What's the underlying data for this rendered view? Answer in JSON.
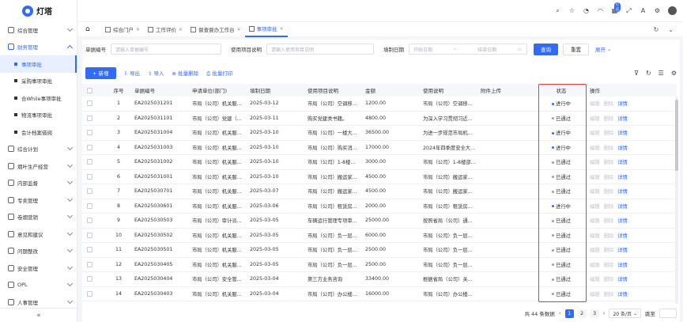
{
  "app": {
    "name": "灯塔"
  },
  "colors": {
    "primary": "#2f6bff",
    "status_running": "#2f6bff",
    "status_passed": "#9aa0a6",
    "highlight_border": "#e0403a"
  },
  "sidebar": {
    "items_top": [
      {
        "label": "综合管理",
        "icon": "grid-icon"
      },
      {
        "label": "财务管理",
        "icon": "finance-icon"
      }
    ],
    "sub_items": [
      {
        "label": "事项审批"
      },
      {
        "label": "采购事项审批"
      },
      {
        "label": "合While事项审批"
      },
      {
        "label": "物流事项审批"
      },
      {
        "label": "会计档案借阅"
      }
    ],
    "items_bottom": [
      {
        "label": "综合计划",
        "icon": "plan-icon"
      },
      {
        "label": "烟叶生产经营",
        "icon": "leaf-icon"
      },
      {
        "label": "内部监督",
        "icon": "monitor-icon"
      },
      {
        "label": "专卖管理",
        "icon": "monopoly-icon"
      },
      {
        "label": "卷烟营销",
        "icon": "marketing-icon"
      },
      {
        "label": "意见和建议",
        "icon": "feedback-icon"
      },
      {
        "label": "问题整改",
        "icon": "rectify-icon"
      },
      {
        "label": "安全管理",
        "icon": "shield-icon"
      },
      {
        "label": "OPL",
        "icon": "opl-icon"
      },
      {
        "label": "人事管理",
        "icon": "person-icon"
      }
    ],
    "collapse_glyph": "«"
  },
  "topbar": {
    "badge": "灯塔"
  },
  "tabs": [
    {
      "label": "综合门户",
      "active": false
    },
    {
      "label": "工作评价",
      "active": false
    },
    {
      "label": "督查督办工作台",
      "active": false
    },
    {
      "label": "事项审批",
      "active": true
    }
  ],
  "filters": {
    "doc_no_label": "单据编号",
    "doc_no_placeholder": "请输入单据编号",
    "usage_label": "使用项目说明",
    "usage_placeholder": "请输入使用项目说明",
    "date_label": "填制日期",
    "date_start_placeholder": "开始日期",
    "date_sep": "~",
    "date_end_placeholder": "结束日期",
    "search_label": "查询",
    "reset_label": "重置",
    "expand_label": "展开"
  },
  "toolbar": {
    "add_label": "+ 新增",
    "export_label": "导出",
    "import_label": "导入",
    "batch_delete_label": "批量删除",
    "batch_print_label": "批量打印"
  },
  "table": {
    "columns": [
      "序号",
      "单据编号",
      "申请单位(部门)",
      "填制日期",
      "使用项目说明",
      "金额",
      "使用说明",
      "附件上传",
      "状态",
      "操作"
    ],
    "ops": [
      "编辑",
      "删除",
      "详情"
    ],
    "rows": [
      {
        "seq": "1",
        "no": "EA2025031201",
        "unit": "市局（公司）机关服...",
        "date": "2025-03-12",
        "desc": "市局（公司）空调移...",
        "amount": "1200.00",
        "use": "市局（公司）空调移...",
        "status": "进行中"
      },
      {
        "seq": "2",
        "no": "EA2025031101",
        "unit": "市局（公司）党建（...",
        "date": "2025-03-11",
        "desc": "购买党建类书籍。",
        "amount": "4800.00",
        "use": "为深入学习贯彻习近...",
        "status": "已通过"
      },
      {
        "seq": "3",
        "no": "EA2025031004",
        "unit": "市局（公司）机关服...",
        "date": "2025-03-10",
        "desc": "市局（公司）一楼大...",
        "amount": "36500.00",
        "use": "为进一步规范市局机...",
        "status": "进行中"
      },
      {
        "seq": "4",
        "no": "EA2025031003",
        "unit": "市局（公司）机关服...",
        "date": "2025-03-10",
        "desc": "市局（公司）购买消...",
        "amount": "17000.00",
        "use": "2024年四季度安全大...",
        "status": "进行中"
      },
      {
        "seq": "5",
        "no": "EA2025031002",
        "unit": "市局（公司）机关服...",
        "date": "2025-03-10",
        "desc": "市局（公司）1-8楼...",
        "amount": "3000.00",
        "use": "市局（公司）1-8楼部...",
        "status": "已通过"
      },
      {
        "seq": "6",
        "no": "EA2025031001",
        "unit": "市局（公司）机关服...",
        "date": "2025-03-10",
        "desc": "市局（公司）搬运家...",
        "amount": "4500.00",
        "use": "市局（公司）搬运家...",
        "status": "已通过"
      },
      {
        "seq": "7",
        "no": "EA2025030701",
        "unit": "市局（公司）机关服...",
        "date": "2025-03-07",
        "desc": "市局（公司）搬运家...",
        "amount": "4500.00",
        "use": "市局（公司）搬运家...",
        "status": "已通过"
      },
      {
        "seq": "8",
        "no": "EA2025030601",
        "unit": "市局（公司）机关服...",
        "date": "2025-03-06",
        "desc": "市局（公司）租赁房...",
        "amount": "2000.00",
        "use": "市局（公司）租赁房...",
        "status": "进行中"
      },
      {
        "seq": "9",
        "no": "EA2025030503",
        "unit": "市局（公司）审计派...",
        "date": "2025-03-05",
        "desc": "车辆运行管理专项审...",
        "amount": "25000.00",
        "use": "按照省局（公司）通...",
        "status": "已通过"
      },
      {
        "seq": "10",
        "no": "EA2025030502",
        "unit": "市局（公司）机关服...",
        "date": "2025-03-05",
        "desc": "市局（公司）负一层...",
        "amount": "6000.00",
        "use": "市局（公司）负一层...",
        "status": "已通过"
      },
      {
        "seq": "11",
        "no": "EA2025030501",
        "unit": "市局（公司）机关服...",
        "date": "2025-03-05",
        "desc": "市局（公司）负一层...",
        "amount": "2500.00",
        "use": "市局（公司）负一层...",
        "status": "已通过"
      },
      {
        "seq": "12",
        "no": "EA2025030405",
        "unit": "市局（公司）机关服...",
        "date": "2025-03-05",
        "desc": "市局（公司）负一层...",
        "amount": "2500.00",
        "use": "市局（公司）负一层...",
        "status": "已通过"
      },
      {
        "seq": "13",
        "no": "EA2025030404",
        "unit": "市局（公司）安全管...",
        "date": "2025-03-04",
        "desc": "第三方业务咨询",
        "amount": "33400.00",
        "use": "根据省局（公司）关...",
        "status": "已通过"
      },
      {
        "seq": "14",
        "no": "EA2025030403",
        "unit": "市局（公司）机关服...",
        "date": "2025-03-04",
        "desc": "市局（公司）办公楼...",
        "amount": "16000.00",
        "use": "市局（公司）办公楼...",
        "status": "已通过"
      }
    ]
  },
  "pagination": {
    "total_text": "共 44 条数据",
    "pages": [
      "1",
      "2",
      "3"
    ],
    "current": "1",
    "page_size": "20 条/页",
    "jump_label": "跳至"
  }
}
